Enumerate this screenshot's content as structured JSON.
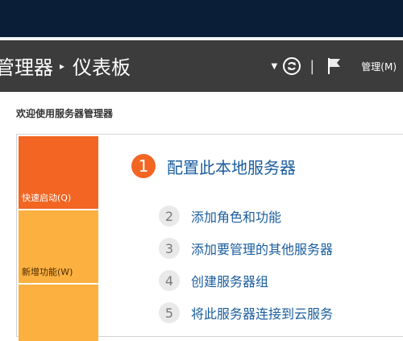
{
  "header": {
    "crumb_parent": "管理器",
    "crumb_current": "仪表板",
    "manage_menu": "管理(M)"
  },
  "welcome": {
    "title": "欢迎使用服务器管理器"
  },
  "tiles": {
    "quick_start": "快速启动(Q)",
    "whats_new": "新增功能(W)",
    "learn_more": ""
  },
  "steps": [
    {
      "num": "1",
      "label": "配置此本地服务器"
    },
    {
      "num": "2",
      "label": "添加角色和功能"
    },
    {
      "num": "3",
      "label": "添加要管理的其他服务器"
    },
    {
      "num": "4",
      "label": "创建服务器组"
    },
    {
      "num": "5",
      "label": "将此服务器连接到云服务"
    }
  ],
  "colors": {
    "header_bg": "#3c3c3c",
    "accent_orange": "#f26522",
    "tile_yellow": "#fbb040",
    "link_blue": "#1a5d9e"
  }
}
